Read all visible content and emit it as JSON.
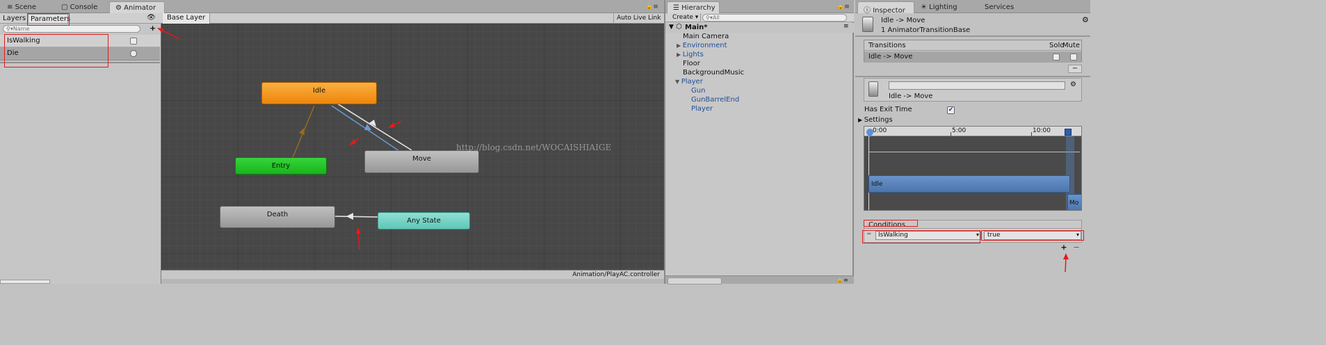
{
  "top_tabs": {
    "scene": "Scene",
    "console": "Console",
    "animator": "Animator"
  },
  "animator": {
    "subtabs": {
      "layers": "Layers",
      "parameters": "Parameters"
    },
    "search_placeholder": "Name",
    "parameters": [
      {
        "name": "IsWalking",
        "kind": "bool"
      },
      {
        "name": "Die",
        "kind": "trigger"
      }
    ],
    "breadcrumb": "Base Layer",
    "auto_live_link": "Auto Live Link",
    "status_path": "Animation/PlayAC.controller",
    "states": {
      "idle": "Idle",
      "entry": "Entry",
      "move": "Move",
      "death": "Death",
      "any_state": "Any State"
    },
    "watermark": "http://blog.csdn.net/WOCAISHIAIGE",
    "colors": {
      "idle": "#f08a0c",
      "entry": "#22c322",
      "any_state": "#6dcfc0",
      "grey_state": "#9a9a9a",
      "graph_bg": "#474747"
    }
  },
  "hierarchy": {
    "tab": "Hierarchy",
    "create_label": "Create",
    "search_placeholder": "All",
    "scene_name": "Main*",
    "items": [
      "Main Camera",
      "Environment",
      "Lights",
      "Floor",
      "BackgroundMusic",
      "Player",
      "Gun",
      "GunBarrelEnd",
      "Player"
    ]
  },
  "inspector": {
    "tabs": {
      "inspector": "Inspector",
      "lighting": "Lighting",
      "services": "Services"
    },
    "title": "Idle -> Move",
    "subtitle": "1 AnimatorTransitionBase",
    "transitions_header": "Transitions",
    "solo": "Solo",
    "mute": "Mute",
    "transition_row": "Idle -> Move",
    "detail_name": "Idle -> Move",
    "has_exit_time": "Has Exit Time",
    "settings": "Settings",
    "timeline_ticks": [
      "0:00",
      "5:00",
      "10:00"
    ],
    "timeline_idle": "Idle",
    "timeline_move": "Mo",
    "conditions": "Conditions",
    "condition_param": "IsWalking",
    "condition_value": "true",
    "plus": "+",
    "minus": "−"
  }
}
